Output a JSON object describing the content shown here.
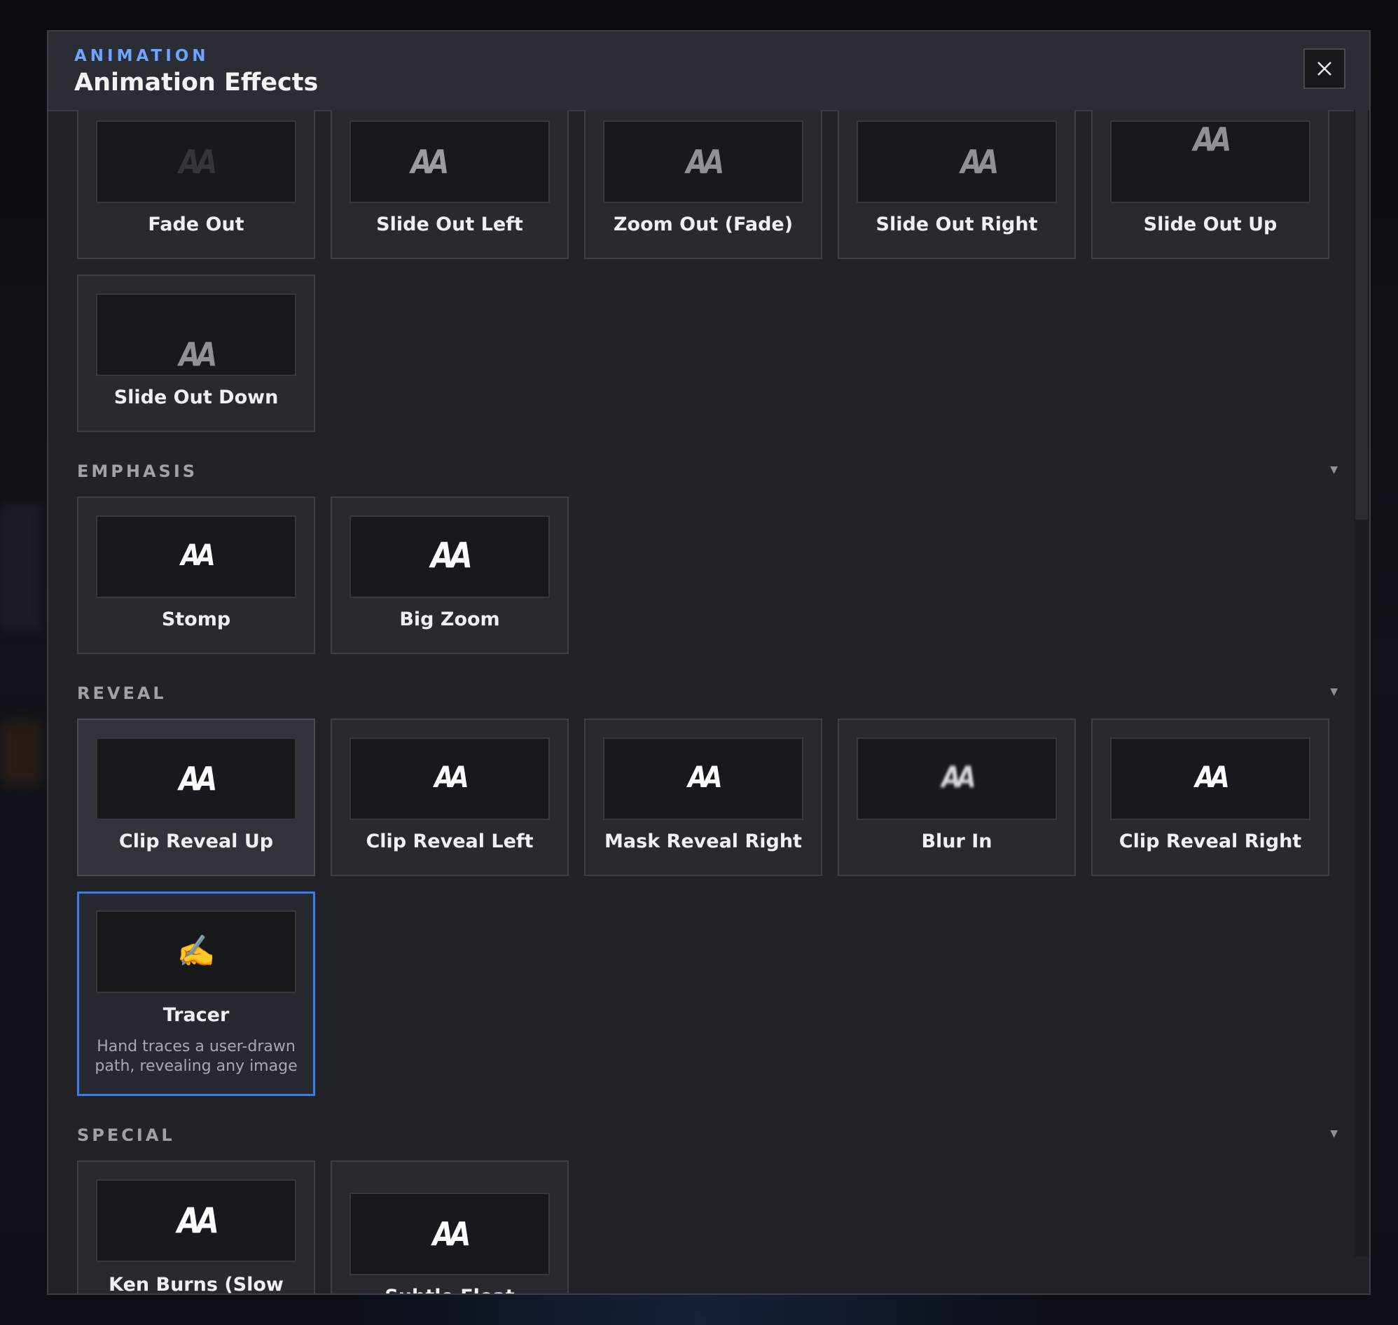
{
  "header": {
    "eyebrow": "ANIMATION",
    "title": "Animation Effects",
    "close_icon": "close-icon"
  },
  "preview_glyph": "AA",
  "sections": [
    {
      "id": "exit",
      "title": "",
      "items": [
        {
          "label": "Fade Out"
        },
        {
          "label": "Slide Out Left"
        },
        {
          "label": "Zoom Out (Fade)"
        },
        {
          "label": "Slide Out Right"
        },
        {
          "label": "Slide Out Up"
        },
        {
          "label": "Slide Out Down"
        }
      ]
    },
    {
      "id": "emphasis",
      "title": "EMPHASIS",
      "caret": "▼",
      "items": [
        {
          "label": "Stomp"
        },
        {
          "label": "Big Zoom"
        }
      ]
    },
    {
      "id": "reveal",
      "title": "REVEAL",
      "caret": "▼",
      "items": [
        {
          "label": "Clip Reveal Up"
        },
        {
          "label": "Clip Reveal Left"
        },
        {
          "label": "Mask Reveal Right"
        },
        {
          "label": "Blur In"
        },
        {
          "label": "Clip Reveal Right"
        },
        {
          "label": "Tracer",
          "icon": "✍️",
          "description": "Hand traces a user-drawn path, revealing any image"
        }
      ]
    },
    {
      "id": "special",
      "title": "SPECIAL",
      "caret": "▼",
      "items": [
        {
          "label": "Ken Burns (Slow Pan/Zoom)"
        },
        {
          "label": "Subtle Float"
        }
      ]
    }
  ],
  "colors": {
    "accent": "#3f79f0",
    "eyebrow": "#6ea3ff",
    "background": "#212328"
  }
}
